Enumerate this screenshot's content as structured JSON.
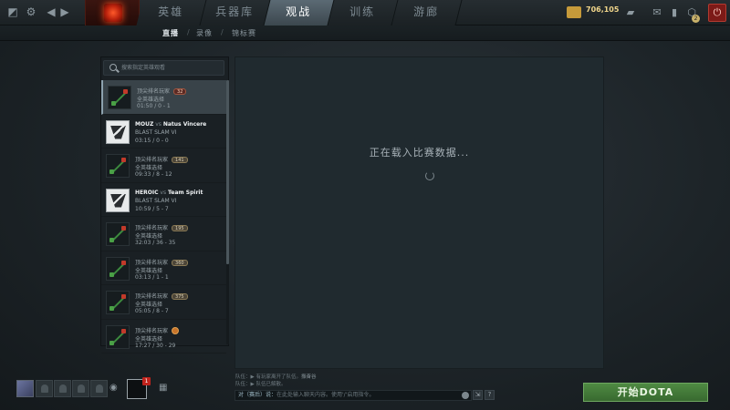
{
  "nav": {
    "tabs": [
      {
        "label": "英雄"
      },
      {
        "label": "兵器库"
      },
      {
        "label": "观战",
        "active": true
      },
      {
        "label": "训练"
      },
      {
        "label": "游廊"
      }
    ]
  },
  "currency": {
    "gold": "706,105"
  },
  "notifications": {
    "count": "2"
  },
  "subnav": {
    "items": [
      "直播",
      "录像",
      "锦标赛"
    ],
    "separator": "/"
  },
  "search": {
    "placeholder": "搜索指定英雄观看"
  },
  "matches": [
    {
      "line1": "顶尖排名玩家",
      "badge": "32",
      "line2": "全英雄选择",
      "line3": "01:50 / 0 - 1"
    },
    {
      "team_a": "MOUZ",
      "vs": "vs",
      "team_b": "Natus Vincere",
      "line2": "BLAST SLAM VI",
      "line3": "03:15 / 0 - 0"
    },
    {
      "line1": "顶尖排名玩家",
      "badge": "141",
      "line2": "全英雄选择",
      "line3": "09:33 / 8 - 12"
    },
    {
      "team_a": "HEROIC",
      "vs": "vs",
      "team_b": "Team Spirit",
      "line2": "BLAST SLAM VI",
      "line3": "10:59 / 5 - 7"
    },
    {
      "line1": "顶尖排名玩家",
      "badge": "195",
      "line2": "全英雄选择",
      "line3": "32:03 / 36 - 35"
    },
    {
      "line1": "顶尖排名玩家",
      "badge": "360",
      "line2": "全英雄选择",
      "line3": "03:13 / 1 - 1"
    },
    {
      "line1": "顶尖排名玩家",
      "badge": "375",
      "line2": "全英雄选择",
      "line3": "05:05 / 8 - 7"
    },
    {
      "line1": "顶尖排名玩家",
      "badge": "",
      "line2": "全英雄选择",
      "line3": "17:27 / 30 - 29"
    }
  ],
  "main": {
    "loading": "正在载入比赛数据..."
  },
  "chat": {
    "lines": [
      {
        "prefix": "队伍：",
        "text": "▶ 有玩家离开了队伍。",
        "highlight": "振奋谷"
      },
      {
        "prefix": "队伍：",
        "text": "▶ 队伍已解散。",
        "highlight": ""
      }
    ],
    "channel": "对（赛后）说：",
    "placeholder": "在此处输入聊天内容。使用'/'启用指令。",
    "help": "?"
  },
  "play_button": {
    "label": "开始DOTA"
  },
  "colors": {
    "accent_green": "#4f8a43",
    "selected_row": "#394349",
    "badge_red": "#c0231c"
  }
}
